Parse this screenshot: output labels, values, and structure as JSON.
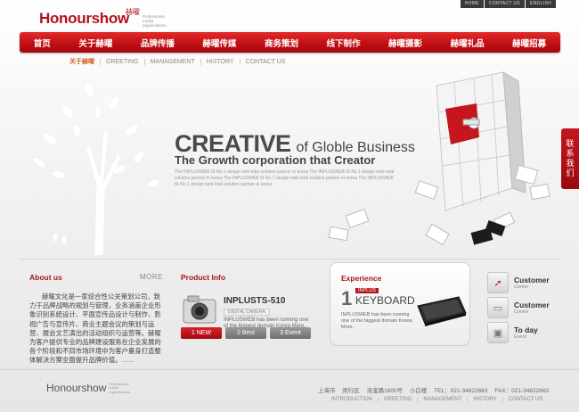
{
  "top_links": [
    "HOME",
    "CONTACT US",
    "ENGLISH"
  ],
  "logo": {
    "word": "Honourshow",
    "chinese": "赫曜",
    "tagline": "Professional media organizations"
  },
  "nav": [
    "首页",
    "关于赫曜",
    "品牌传播",
    "赫曜传媒",
    "商务策划",
    "线下制作",
    "赫曜摄影",
    "赫曜礼品",
    "赫曜招募"
  ],
  "subnav": [
    "关于赫曜",
    "GREETING",
    "MANAGEMENT",
    "HISTORY",
    "CONTACT US"
  ],
  "hero": {
    "title_bold": "CREATIVE",
    "title_rest": "of Globle Business",
    "subtitle": "The Growth corporation that Creator",
    "desc": "The INPLUSWEB IS No.1 design web total solution partner in korea The INPLUSWEB IS No.1 design web total solution partner in korea The INPLUSWEB IS No.1 design web total solution partner in korea The INPLUSWEB IS No.1 design web total solution partner in korea"
  },
  "side_tab": "联系我们",
  "about": {
    "title": "About us",
    "more": "MORE",
    "text": "赫曜文化是一家综合性公关策划公司，致力于品牌战略的规划与管理，业务涵盖企业形象识别系统设计、平面宣传品设计与制作、影视广告与宣传片、商业主题会议的策划与运营、展会文艺演出的活动组织与运营等。赫曜为客户提供专业的品牌建设服务在企业发展的各个阶段和不同市场环境中为客户量身打造整体解决方案全面提升品牌价值。……"
  },
  "product": {
    "title": "Product Info",
    "name": "INPLUSTS-510",
    "caption": "DIGITAL CAMERA",
    "desc": "INPLUSWEB has been running one of the biggest domain Korea More..",
    "pagers": [
      "1   NEW",
      "2   Best",
      "3   Event"
    ]
  },
  "experience": {
    "title": "Experience",
    "num": "1",
    "kicker": "INPLUS",
    "name": "KEYBOARD",
    "desc": "INPLUSWEB has been running one of the biggest domain Korea More.."
  },
  "customer": [
    {
      "title": "Customer",
      "sub": "Center",
      "icon": "cursor-icon"
    },
    {
      "title": "Customer",
      "sub": "Center",
      "icon": "monitor-icon"
    },
    {
      "title": "To day",
      "sub": "Event",
      "icon": "gift-icon"
    }
  ],
  "footer": {
    "word": "Honourshow",
    "tagline": "Professional media organizations",
    "address": "上海市 闵行区 洛宝路1600号 小白楼    TEL：021-34622663    FAX：021-34622663",
    "links": [
      "INTRODUCTION",
      "GREETING",
      "MANAGEMENT",
      "HISTORY",
      "CONTACT US"
    ]
  },
  "colors": {
    "brand_red": "#c4161c",
    "accent_orange": "#d4601a"
  }
}
